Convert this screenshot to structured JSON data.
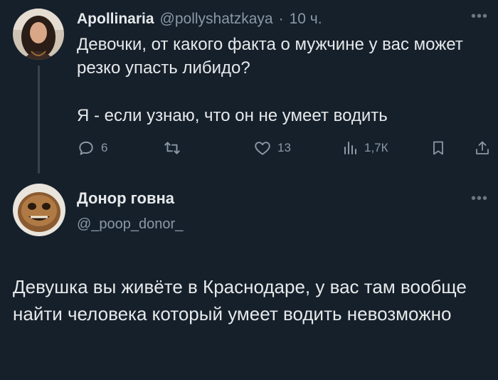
{
  "colors": {
    "background": "#15202b",
    "text": "#e7e9ea",
    "muted": "#8b98a5",
    "thread_line": "#38444d"
  },
  "tweet1": {
    "display_name": "Apollinaria",
    "handle": "@pollyshatzkaya",
    "separator": "·",
    "time": "10 ч.",
    "more_icon": "more-icon",
    "text_line1": "Девочки, от какого факта о мужчине у вас может резко упасть либидо?",
    "text_line2": "Я - если узнаю, что он не умеет водить",
    "actions": {
      "reply_count": "6",
      "like_count": "13",
      "views_count": "1,7К",
      "icons": [
        "reply-icon",
        "retweet-icon",
        "like-icon",
        "views-icon",
        "bookmark-icon",
        "share-icon"
      ]
    }
  },
  "tweet2": {
    "display_name": "Донор говна",
    "handle": "@_poop_donor_",
    "more_icon": "more-icon",
    "text": "Девушка вы живёте в Краснодаре, у вас там вообще найти человека который умеет водить невозможно"
  }
}
